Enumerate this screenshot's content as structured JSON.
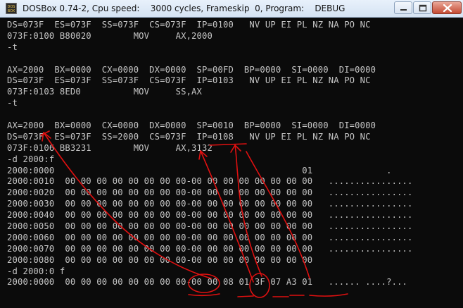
{
  "window": {
    "title": "DOSBox 0.74-2, Cpu speed:    3000 cycles, Frameskip  0, Program:    DEBUG",
    "icon_label_top": "DOS",
    "icon_label_bottom": "BOX",
    "buttons": {
      "minimize": "minimize",
      "maximize": "maximize",
      "close": "close"
    }
  },
  "console_lines": [
    "DS=073F  ES=073F  SS=073F  CS=073F  IP=0100   NV UP EI PL NZ NA PO NC",
    "073F:0100 B80020        MOV     AX,2000",
    "-t",
    "",
    "AX=2000  BX=0000  CX=0000  DX=0000  SP=00FD  BP=0000  SI=0000  DI=0000",
    "DS=073F  ES=073F  SS=073F  CS=073F  IP=0103   NV UP EI PL NZ NA PO NC",
    "073F:0103 8ED0          MOV     SS,AX",
    "-t",
    "",
    "AX=2000  BX=0000  CX=0000  DX=0000  SP=0010  BP=0000  SI=0000  DI=0000",
    "DS=073F  ES=073F  SS=2000  CS=073F  IP=0108   NV UP EI PL NZ NA PO NC",
    "073F:0106 BB3231        MOV     AX,3132",
    "-d 2000:f",
    "2000:0000                                               01              .",
    "2000:0010  00 00 00 00 00 00 00 00-00 00 00 00 00 00 00 00   ................",
    "2000:0020  00 00 00 00 00 00 00 00-00 00 00 00 00 00 00 00   ................",
    "2000:0030  00 00 00 00 00 00 00 00-00 00 00 00 00 00 00 00   ................",
    "2000:0040  00 00 00 00 00 00 00 00-00 00 00 00 00 00 00 00   ................",
    "2000:0050  00 00 00 00 00 00 00 00-00 00 00 00 00 00 00 00   ................",
    "2000:0060  00 00 00 00 00 00 00 00-00 00 00 00 00 00 00 00   ................",
    "2000:0070  00 00 00 00 00 00 00 00-00 00 00 00 00 00 00 00   ................",
    "2000:0080  00 00 00 00 00 00 00 00-00 00 00 00 00 00 00 00",
    "-d 2000:0 f",
    "2000:0000  00 00 00 00 00 00 00 00-00 00 08 01 3F 07 A3 01   ...... ....?..."
  ],
  "colors": {
    "console_bg": "#0b0b0b",
    "console_fg": "#c6c6c6",
    "annotation": "#e01010",
    "titlebar": "#dbe7f5"
  }
}
